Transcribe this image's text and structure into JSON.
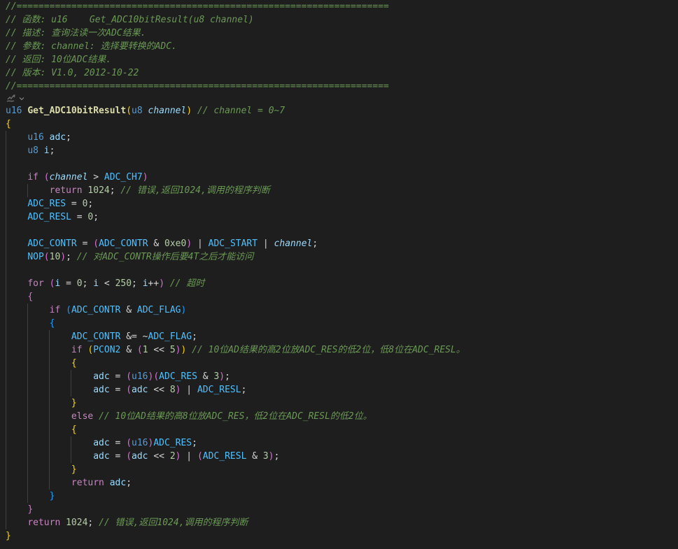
{
  "lines": [
    "//====================================================================",
    "// 函数: u16    Get_ADC10bitResult(u8 channel)",
    "// 描述: 查询法读一次ADC结果.",
    "// 参数: channel: 选择要转换的ADC.",
    "// 返回: 10位ADC结果.",
    "// 版本: V1.0, 2012-10-22",
    "//====================================================================",
    "",
    "u16 Get_ADC10bitResult(u8 channel) // channel = 0~7",
    "{",
    "    u16 adc;",
    "    u8 i;",
    "",
    "    if (channel > ADC_CH7)",
    "        return 1024; // 错误,返回1024,调用的程序判断",
    "    ADC_RES = 0;",
    "    ADC_RESL = 0;",
    "",
    "    ADC_CONTR = (ADC_CONTR & 0xe0) | ADC_START | channel;",
    "    NOP(10); // 对ADC_CONTR操作后要4T之后才能访问",
    "",
    "    for (i = 0; i < 250; i++) // 超时",
    "    {",
    "        if (ADC_CONTR & ADC_FLAG)",
    "        {",
    "            ADC_CONTR &= ~ADC_FLAG;",
    "            if (PCON2 & (1 << 5)) // 10位AD结果的高2位放ADC_RES的低2位，低8位在ADC_RESL。",
    "            {",
    "                adc = (u16)(ADC_RES & 3);",
    "                adc = (adc << 8) | ADC_RESL;",
    "            }",
    "            else // 10位AD结果的高8位放ADC_RES，低2位在ADC_RESL的低2位。",
    "            {",
    "                adc = (u16)ADC_RES;",
    "                adc = (adc << 2) | (ADC_RESL & 3);",
    "            }",
    "            return adc;",
    "        }",
    "    }",
    "    return 1024; // 错误,返回1024,调用的程序判断",
    "}"
  ],
  "icons": {
    "fold_gutter": "copilot-sparkle-icon",
    "fold_chevron": "chevron-down-icon"
  },
  "colors": {
    "background": "#1e1e1e",
    "comment": "#6a9955",
    "type": "#569cd6",
    "function": "#dcdcaa",
    "parameter": "#9cdcfe",
    "keyword": "#c586c0",
    "number": "#b5cea8",
    "macro": "#4fc1ff",
    "bracket_gold": "#ffd700",
    "bracket_orchid": "#da70d6",
    "bracket_blue": "#179fff"
  }
}
